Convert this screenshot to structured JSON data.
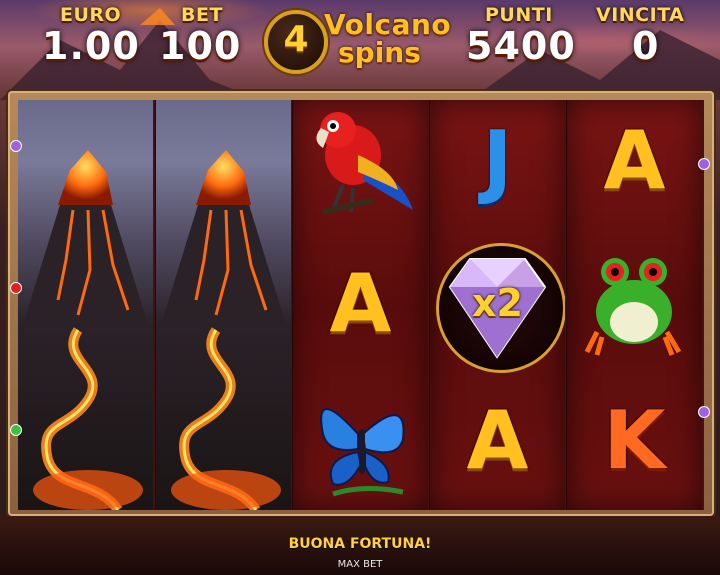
{
  "hud": {
    "euro_label": "EURO",
    "euro_value": "1.00",
    "bet_label": "BET",
    "bet_value": "100",
    "punti_label": "PUNTI",
    "punti_value": "5400",
    "vincita_label": "VINCITA",
    "vincita_value": "0"
  },
  "logo": {
    "number": "4",
    "word1": "Volcano",
    "word2": "spins"
  },
  "reels": [
    {
      "symbols": [
        "volcano-stacked"
      ]
    },
    {
      "symbols": [
        "volcano-stacked"
      ]
    },
    {
      "symbols": [
        "parrot",
        "A",
        "butterfly"
      ]
    },
    {
      "symbols": [
        "J",
        "diamond-x2",
        "A"
      ]
    },
    {
      "symbols": [
        "A",
        "frog",
        "K"
      ]
    }
  ],
  "symbols": {
    "letter_a": "A",
    "letter_j": "J",
    "letter_k": "K",
    "multiplier": "x2"
  },
  "message": "BUONA FORTUNA!",
  "max_bet_label": "MAX BET",
  "colors": {
    "gold": "#ffd040",
    "reel_red": "#7a1414",
    "frame": "#b48a5a"
  }
}
